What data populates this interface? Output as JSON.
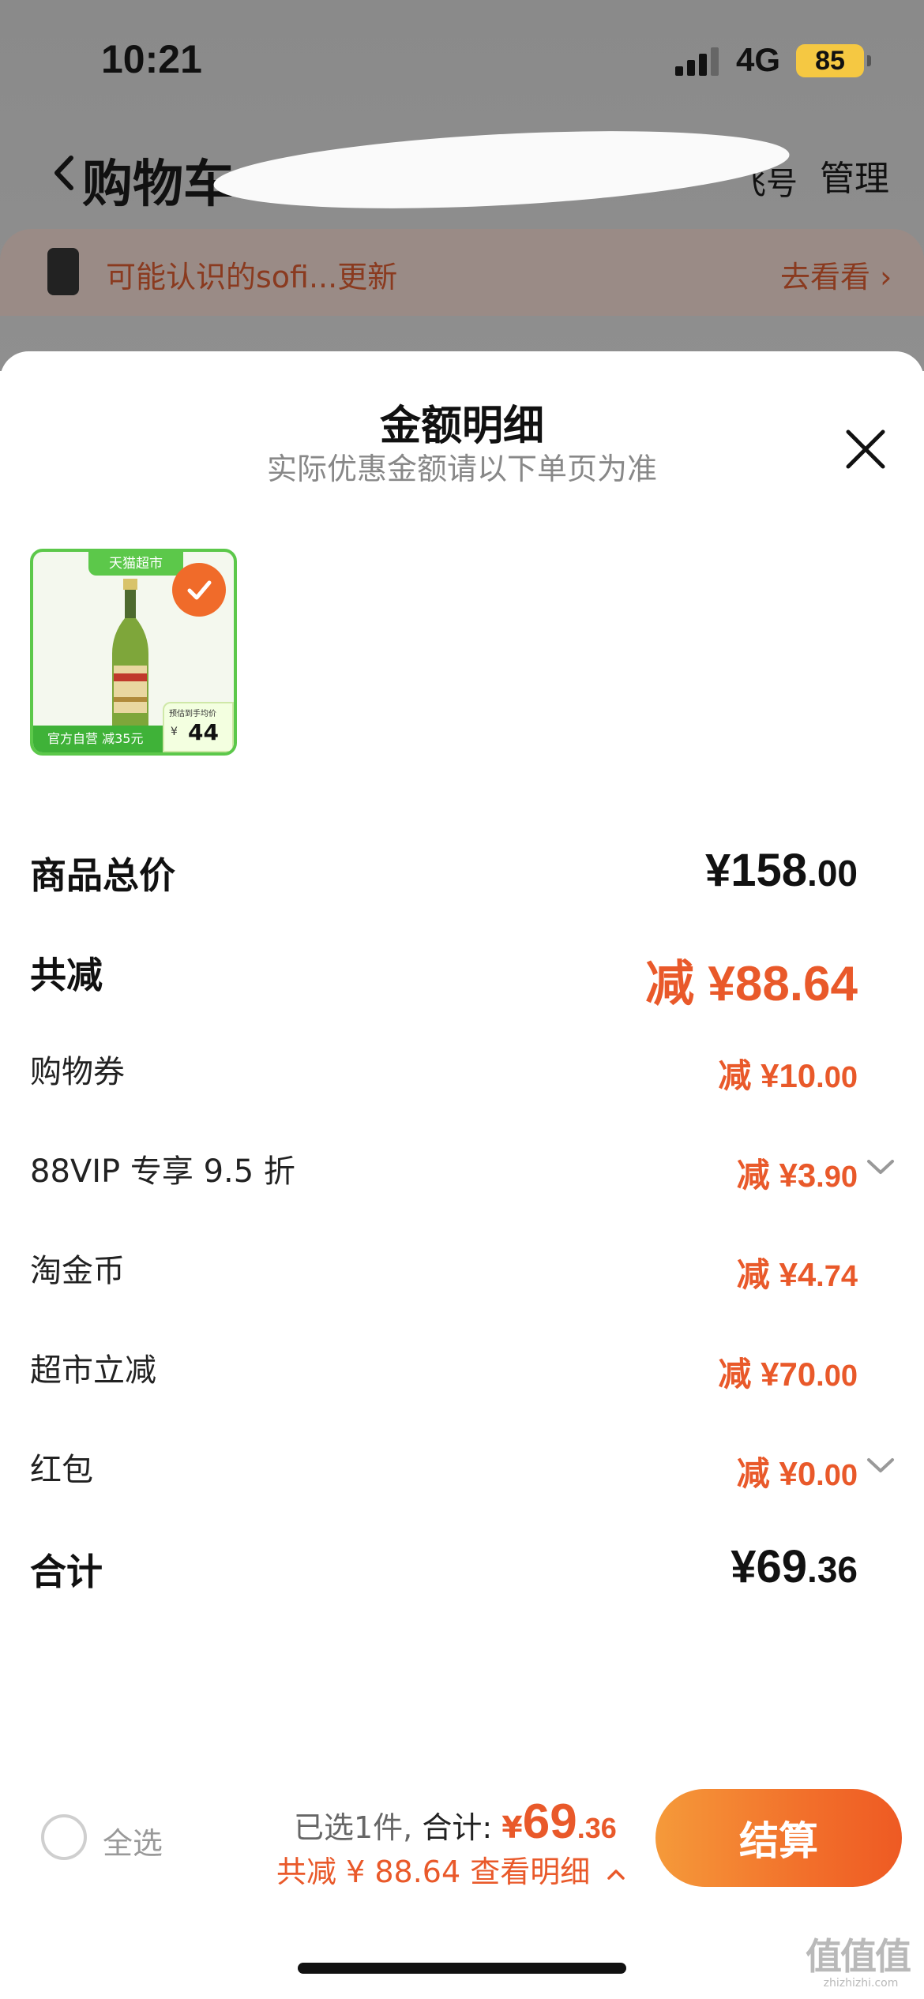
{
  "status_bar": {
    "time": "10:21",
    "network": "4G",
    "battery": "85"
  },
  "nav": {
    "title": "购物车",
    "extra": "飞号",
    "manage": "管理"
  },
  "notice": {
    "text": "可能认识的sofi...更新",
    "link": "去看看"
  },
  "sheet": {
    "title": "金额明细",
    "subtitle": "实际优惠金额请以下单页为准",
    "product": {
      "store_tag": "天猫超市",
      "bottom_tag": "官方自营 减35元",
      "price_label": "预估到手均价",
      "price_currency": "¥",
      "price_value": "44"
    },
    "rows": [
      {
        "label": "商品总价",
        "value_int": "¥158",
        "value_cents": ".00"
      },
      {
        "label": "共减",
        "value": "减 ¥88.64"
      },
      {
        "label": "购物券",
        "prefix": "减 ¥",
        "int": "10",
        "cents": ".00"
      },
      {
        "label": "88VIP 专享 9.5 折",
        "prefix": "减 ¥",
        "int": "3",
        "cents": ".90"
      },
      {
        "label": "淘金币",
        "prefix": "减 ¥",
        "int": "4",
        "cents": ".74"
      },
      {
        "label": "超市立减",
        "prefix": "减 ¥",
        "int": "70",
        "cents": ".00"
      },
      {
        "label": "红包",
        "prefix": "减 ¥",
        "int": "0",
        "cents": ".00"
      },
      {
        "label": "合计",
        "value_int": "¥69",
        "value_cents": ".36"
      }
    ]
  },
  "checkout": {
    "select_all": "全选",
    "selected_text": "已选1件,",
    "total_label": "合计:",
    "total_currency": "¥",
    "total_int": "69",
    "total_cents": ".36",
    "discount_text": "共减 ¥ 88.64",
    "details_link": "查看明细",
    "button": "结算"
  },
  "watermark": {
    "glyphs": "值值值",
    "url": "zhizhizhi.com"
  },
  "colors": {
    "accent": "#e9592a",
    "checkout_gradient_start": "#f59a3a",
    "checkout_gradient_end": "#ee5a23",
    "store_green": "#5cc84a"
  },
  "icons": [
    "signal-icon",
    "battery-icon",
    "back-icon",
    "close-icon",
    "check-icon",
    "chevron-down-icon",
    "chevron-up-icon"
  ]
}
